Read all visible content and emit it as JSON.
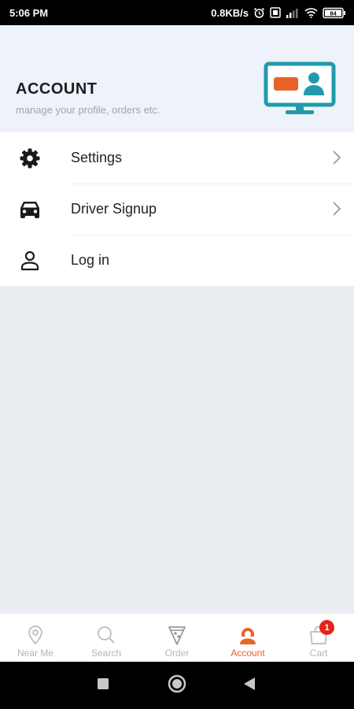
{
  "status_bar": {
    "time": "5:06 PM",
    "network_speed": "0.8KB/s",
    "battery_level": "84"
  },
  "header": {
    "title": "ACCOUNT",
    "subtitle": "manage your profile, orders etc.",
    "colors": {
      "illustration_teal": "#1f9bab",
      "illustration_orange": "#e8632a"
    }
  },
  "menu": {
    "items": [
      {
        "label": "Settings",
        "icon": "gear-icon",
        "has_chevron": true
      },
      {
        "label": "Driver Signup",
        "icon": "car-icon",
        "has_chevron": true
      },
      {
        "label": "Log in",
        "icon": "person-icon",
        "has_chevron": false
      }
    ]
  },
  "bottom_nav": {
    "active": "Account",
    "accent_color": "#e8632a",
    "items": [
      {
        "label": "Near Me",
        "icon": "location-pin-icon"
      },
      {
        "label": "Search",
        "icon": "search-icon"
      },
      {
        "label": "Order",
        "icon": "pizza-slice-icon"
      },
      {
        "label": "Account",
        "icon": "account-icon"
      },
      {
        "label": "Cart",
        "icon": "shopping-bag-icon",
        "badge": "1"
      }
    ]
  },
  "system_nav": {
    "buttons": [
      "recents-square-icon",
      "home-circle-icon",
      "back-triangle-icon"
    ]
  }
}
